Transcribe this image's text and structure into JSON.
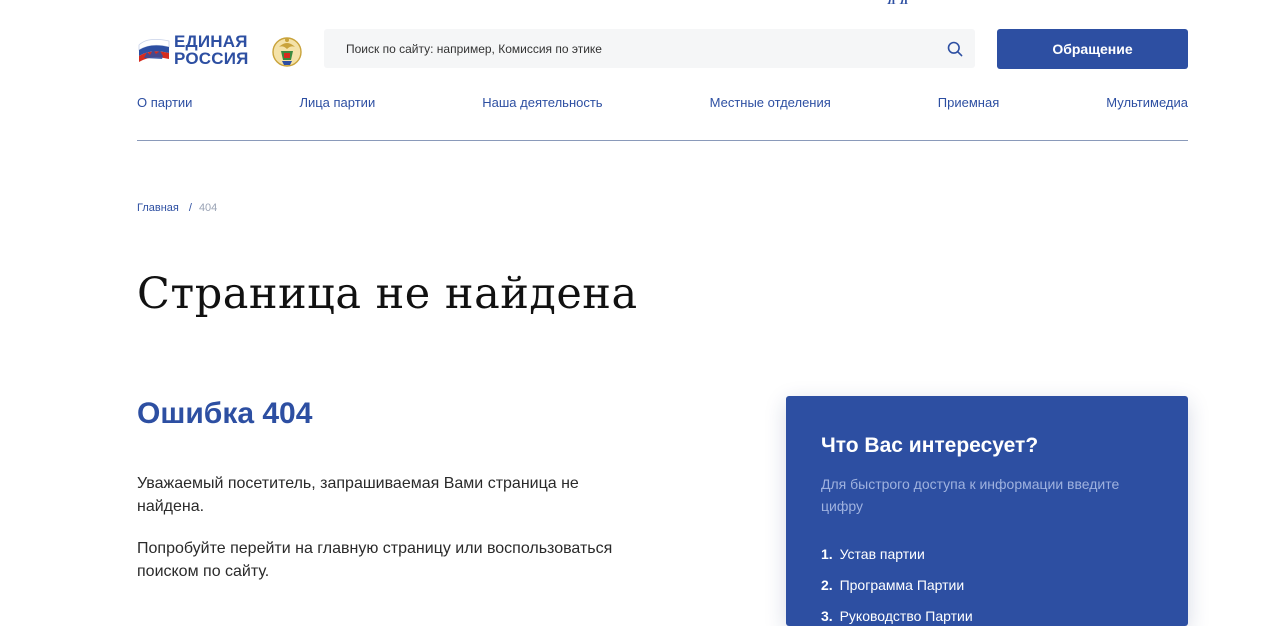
{
  "brand": {
    "name_line1": "ЕДИНАЯ",
    "name_line2": "РОССИЯ",
    "accent_color": "#2d4fa2"
  },
  "header": {
    "search_placeholder": "Поиск по сайту: например, Комиссия по этике",
    "appeal_button": "Обращение"
  },
  "nav": {
    "items": [
      "О партии",
      "Лица партии",
      "Наша деятельность",
      "Местные отделения",
      "Приемная",
      "Мультимедиа"
    ]
  },
  "breadcrumb": {
    "home": "Главная",
    "separator": "/",
    "current": "404"
  },
  "main": {
    "title": "Страница не найдена",
    "error_heading": "Ошибка 404",
    "paragraph_1": "Уважаемый посетитель, запрашиваемая Вами страница не найдена.",
    "paragraph_2": "Попробуйте перейти на главную страницу или воспользоваться поиском по сайту."
  },
  "panel": {
    "title": "Что Вас интересует?",
    "subtitle": "Для быстрого доступа к информации введите цифру",
    "items": [
      {
        "number": "1.",
        "label": "Устав партии"
      },
      {
        "number": "2.",
        "label": "Программа Партии"
      },
      {
        "number": "3.",
        "label": "Руководство Партии"
      }
    ]
  }
}
